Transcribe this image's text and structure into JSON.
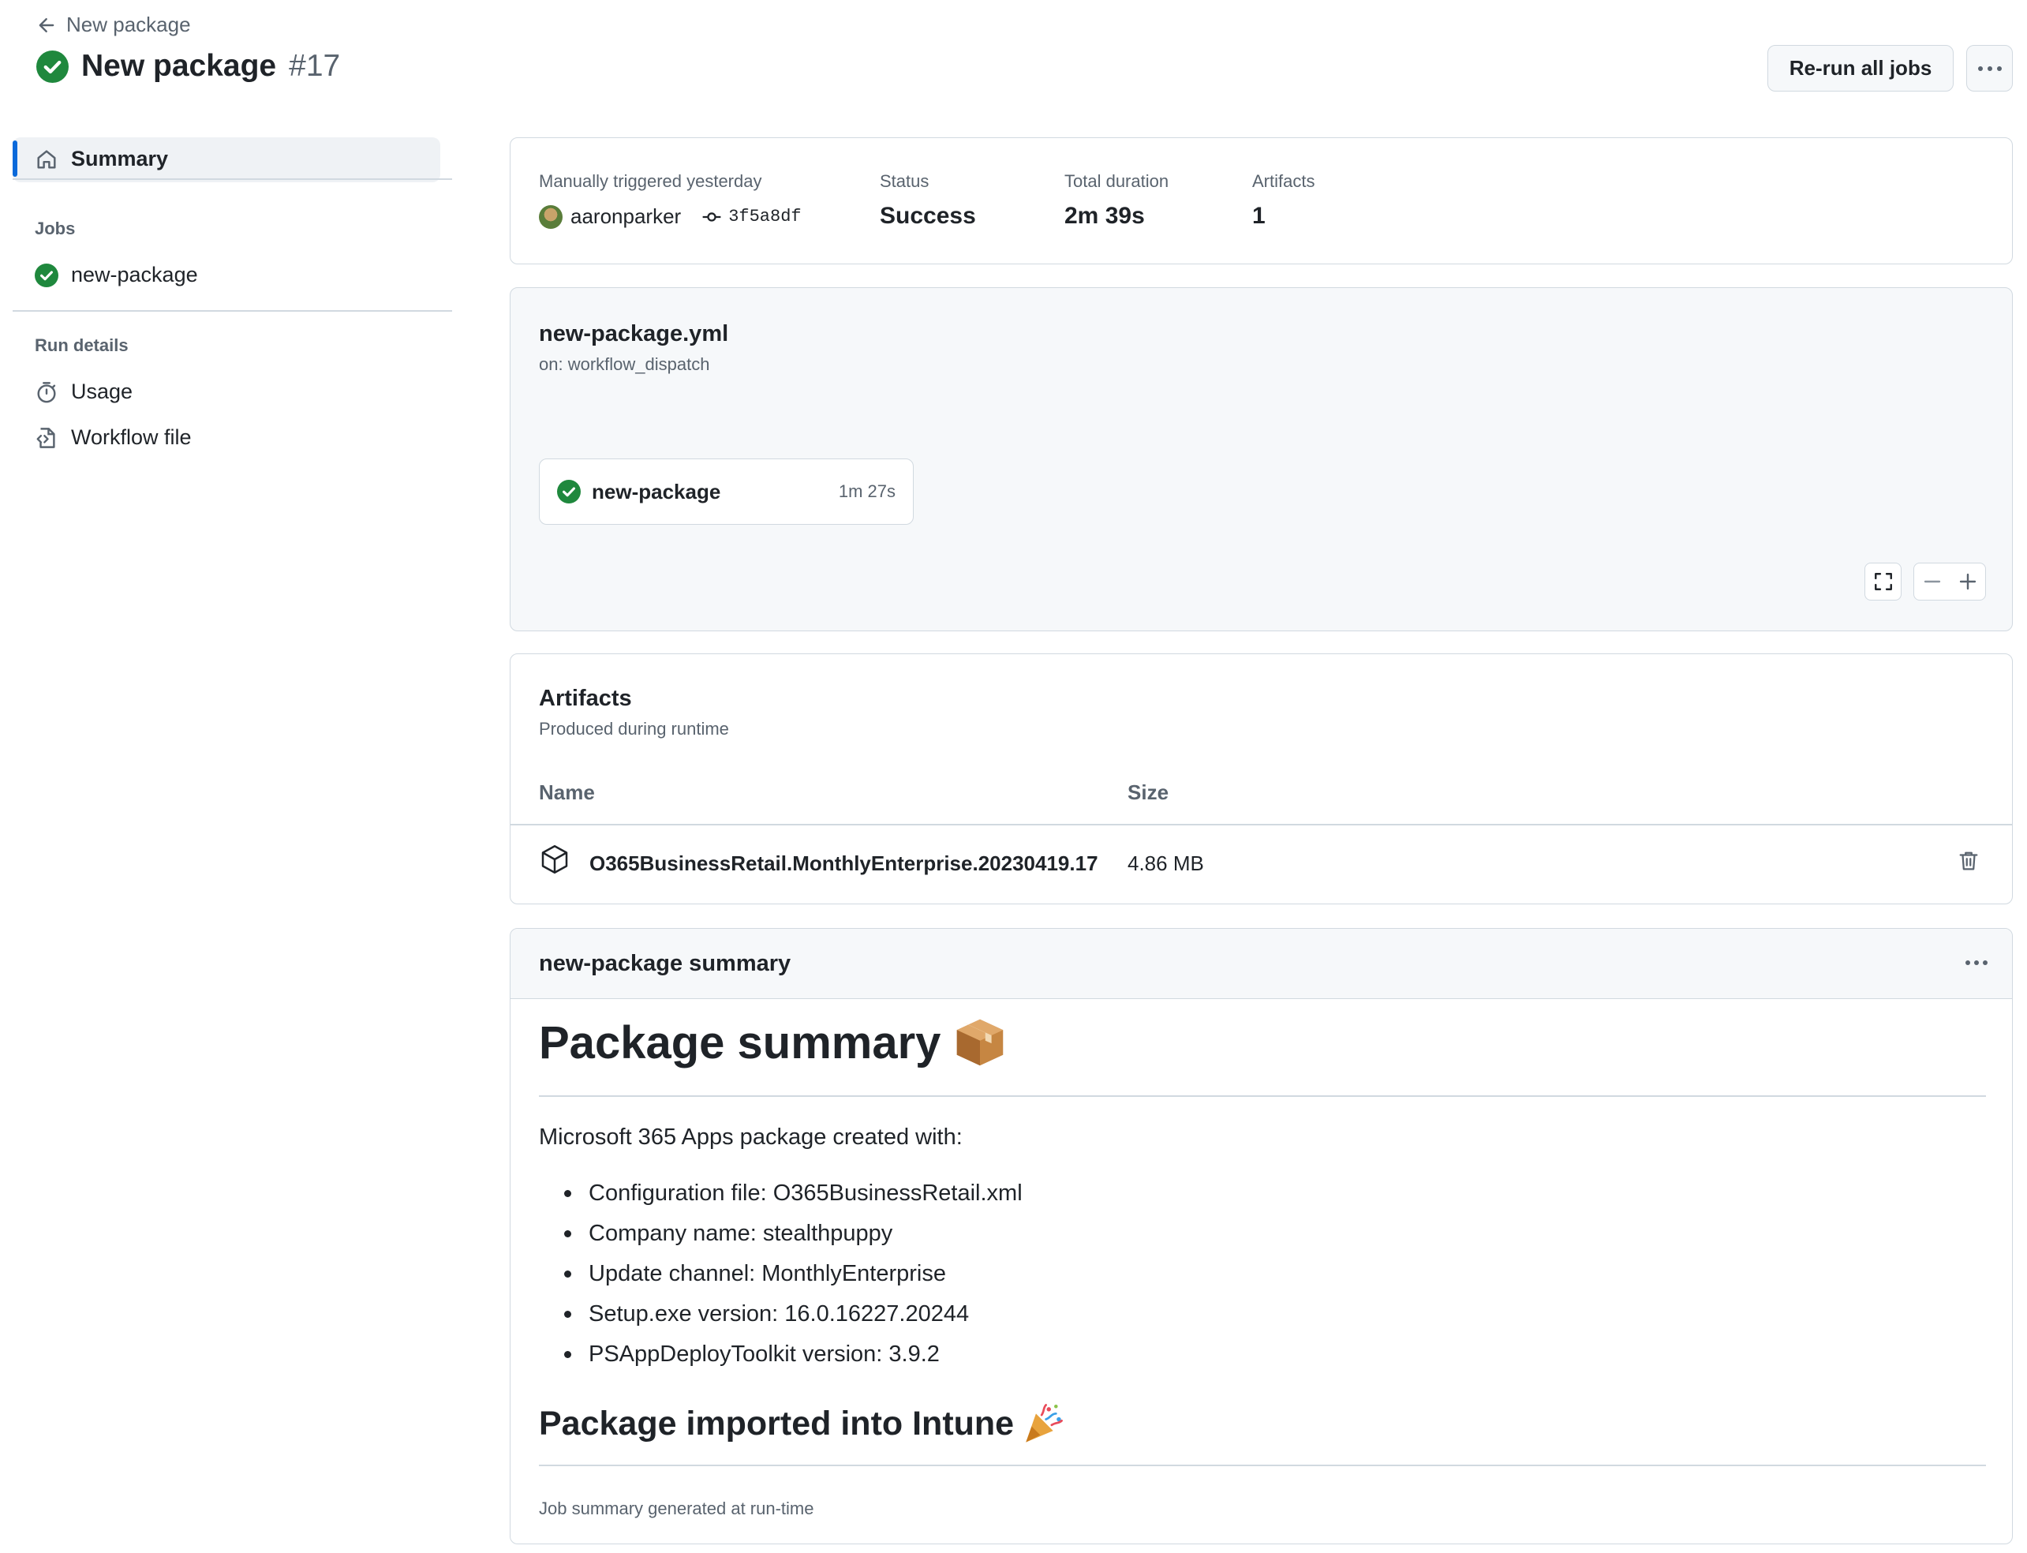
{
  "header": {
    "back_label": "New package",
    "title": "New package",
    "run_number": "#17",
    "rerun_label": "Re-run all jobs"
  },
  "sidebar": {
    "summary_label": "Summary",
    "jobs_heading": "Jobs",
    "jobs": [
      {
        "label": "new-package",
        "status": "success"
      }
    ],
    "run_details_heading": "Run details",
    "usage_label": "Usage",
    "workflow_file_label": "Workflow file"
  },
  "meta": {
    "trigger_label": "Manually triggered yesterday",
    "actor": "aaronparker",
    "commit": "3f5a8df",
    "status_label": "Status",
    "status_value": "Success",
    "duration_label": "Total duration",
    "duration_value": "2m 39s",
    "artifacts_label": "Artifacts",
    "artifacts_value": "1"
  },
  "workflow": {
    "file": "new-package.yml",
    "trigger": "on: workflow_dispatch",
    "job": {
      "name": "new-package",
      "duration": "1m 27s"
    }
  },
  "artifacts": {
    "title": "Artifacts",
    "subtitle": "Produced during runtime",
    "columns": [
      "Name",
      "Size"
    ],
    "rows": [
      {
        "name": "O365BusinessRetail.MonthlyEnterprise.20230419.17",
        "size": "4.86 MB"
      }
    ]
  },
  "summary": {
    "header": "new-package summary",
    "heading": "Package summary",
    "intro": "Microsoft 365 Apps package created with:",
    "items": [
      "Configuration file: O365BusinessRetail.xml",
      "Company name: stealthpuppy",
      "Update channel: MonthlyEnterprise",
      "Setup.exe version: 16.0.16227.20244",
      "PSAppDeployToolkit version: 3.9.2"
    ],
    "heading2": "Package imported into Intune",
    "footer": "Job summary generated at run-time"
  },
  "colors": {
    "success": "#1f883d",
    "accent": "#0969da",
    "muted": "#59636e",
    "border": "#d1d9e0"
  },
  "icons": [
    "arrow-left-icon",
    "check-circle-icon",
    "home-icon",
    "stopwatch-icon",
    "file-code-icon",
    "git-commit-icon",
    "package-icon",
    "trash-icon",
    "kebab-icon",
    "fullscreen-icon",
    "zoom-out-icon",
    "zoom-in-icon"
  ]
}
